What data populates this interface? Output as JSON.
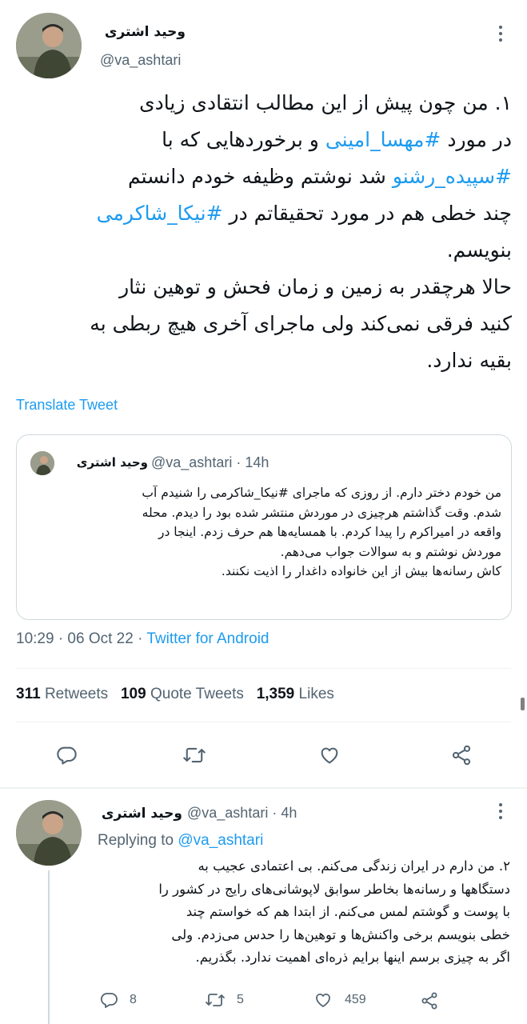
{
  "main_tweet": {
    "display_name": "وحید اشتری",
    "handle": "@va_ashtari",
    "text_lines": [
      {
        "parts": [
          {
            "t": "۱. من چون پیش از این مطالب انتقادی زیادی",
            "link": false
          }
        ]
      },
      {
        "parts": [
          {
            "t": "در مورد ",
            "link": false
          },
          {
            "t": "#مهسا_امینی",
            "link": true
          },
          {
            "t": " و برخوردهایی که با",
            "link": false
          }
        ]
      },
      {
        "parts": [
          {
            "t": "#سپیده_رشنو",
            "link": true
          },
          {
            "t": " شد نوشتم وظیفه خودم دانستم",
            "link": false
          }
        ]
      },
      {
        "parts": [
          {
            "t": "چند خطی هم در مورد تحقیقاتم در ",
            "link": false
          },
          {
            "t": "#نیکا_شاکرمی",
            "link": true
          }
        ]
      },
      {
        "parts": [
          {
            "t": "بنویسم.",
            "link": false
          }
        ]
      },
      {
        "parts": [
          {
            "t": "حالا هرچقدر به زمین و زمان فحش و توهین نثار",
            "link": false
          }
        ]
      },
      {
        "parts": [
          {
            "t": "کنید فرقی نمی‌کند ولی ماجرای آخری هیچ ربطی به",
            "link": false
          }
        ]
      },
      {
        "parts": [
          {
            "t": "بقیه ندارد.",
            "link": false
          }
        ]
      }
    ],
    "translate_label": "Translate Tweet",
    "timestamp": "10:29 · 06 Oct 22 · ",
    "source": "Twitter for Android",
    "stats": {
      "retweets_count": "311",
      "retweets_label": "Retweets",
      "quotes_count": "109",
      "quotes_label": "Quote Tweets",
      "likes_count": "1,359",
      "likes_label": "Likes"
    }
  },
  "quoted_tweet": {
    "display_name": "وحید اشتری",
    "handle_time": "@va_ashtari · 14h",
    "text_lines": [
      {
        "parts": [
          {
            "t": "من خودم دختر دارم. از روزی که ماجرای #نیکا_شاکرمی را شنیدم آب",
            "link": false
          }
        ]
      },
      {
        "parts": [
          {
            "t": "شدم. وقت گذاشتم هرچیزی در موردش منتشر شده بود را دیدم. محله",
            "link": false
          }
        ]
      },
      {
        "parts": [
          {
            "t": "واقعه در امیراکرم را پیدا کردم. با همسایه‌ها هم حرف زدم. اینجا در",
            "link": false
          }
        ]
      },
      {
        "parts": [
          {
            "t": "موردش نوشتم و به سوالات جواب می‌دهم.",
            "link": false
          }
        ]
      },
      {
        "parts": [
          {
            "t": "کاش رسانه‌ها بیش از این خانواده داغدار را اذیت نکنند.",
            "link": false
          }
        ]
      }
    ]
  },
  "reply_tweet": {
    "display_name": "وحید اشتری",
    "handle_time": "@va_ashtari · 4h",
    "replying_to_label": "Replying to ",
    "replying_to_handle": "@va_ashtari",
    "text_lines": [
      {
        "parts": [
          {
            "t": "۲. من دارم در ایران زندگی می‌کنم. بی اعتمادی عجیب به",
            "link": false
          }
        ]
      },
      {
        "parts": [
          {
            "t": "دستگاهها و رسانه‌ها بخاطر سوابق لاپوشانی‌های رایج در کشور را",
            "link": false
          }
        ]
      },
      {
        "parts": [
          {
            "t": "با پوست و گوشتم لمس می‌کنم. از ابتدا هم که خواستم چند",
            "link": false
          }
        ]
      },
      {
        "parts": [
          {
            "t": "خطی بنویسم برخی واکنش‌ها و توهین‌ها را حدس می‌زدم. ولی",
            "link": false
          }
        ]
      },
      {
        "parts": [
          {
            "t": "اگر به چیزی برسم اینها برایم ذره‌ای اهمیت ندارد. بگذریم.",
            "link": false
          }
        ]
      }
    ],
    "actions": {
      "replies": "8",
      "retweets": "5",
      "likes": "459"
    }
  },
  "icons": {
    "more": "more-vertical-icon",
    "reply": "reply-icon",
    "retweet": "retweet-icon",
    "like": "heart-icon",
    "share": "share-icon"
  },
  "colors": {
    "link": "#1d9bf0",
    "secondary_text": "#536471",
    "border": "#cfd9de"
  }
}
